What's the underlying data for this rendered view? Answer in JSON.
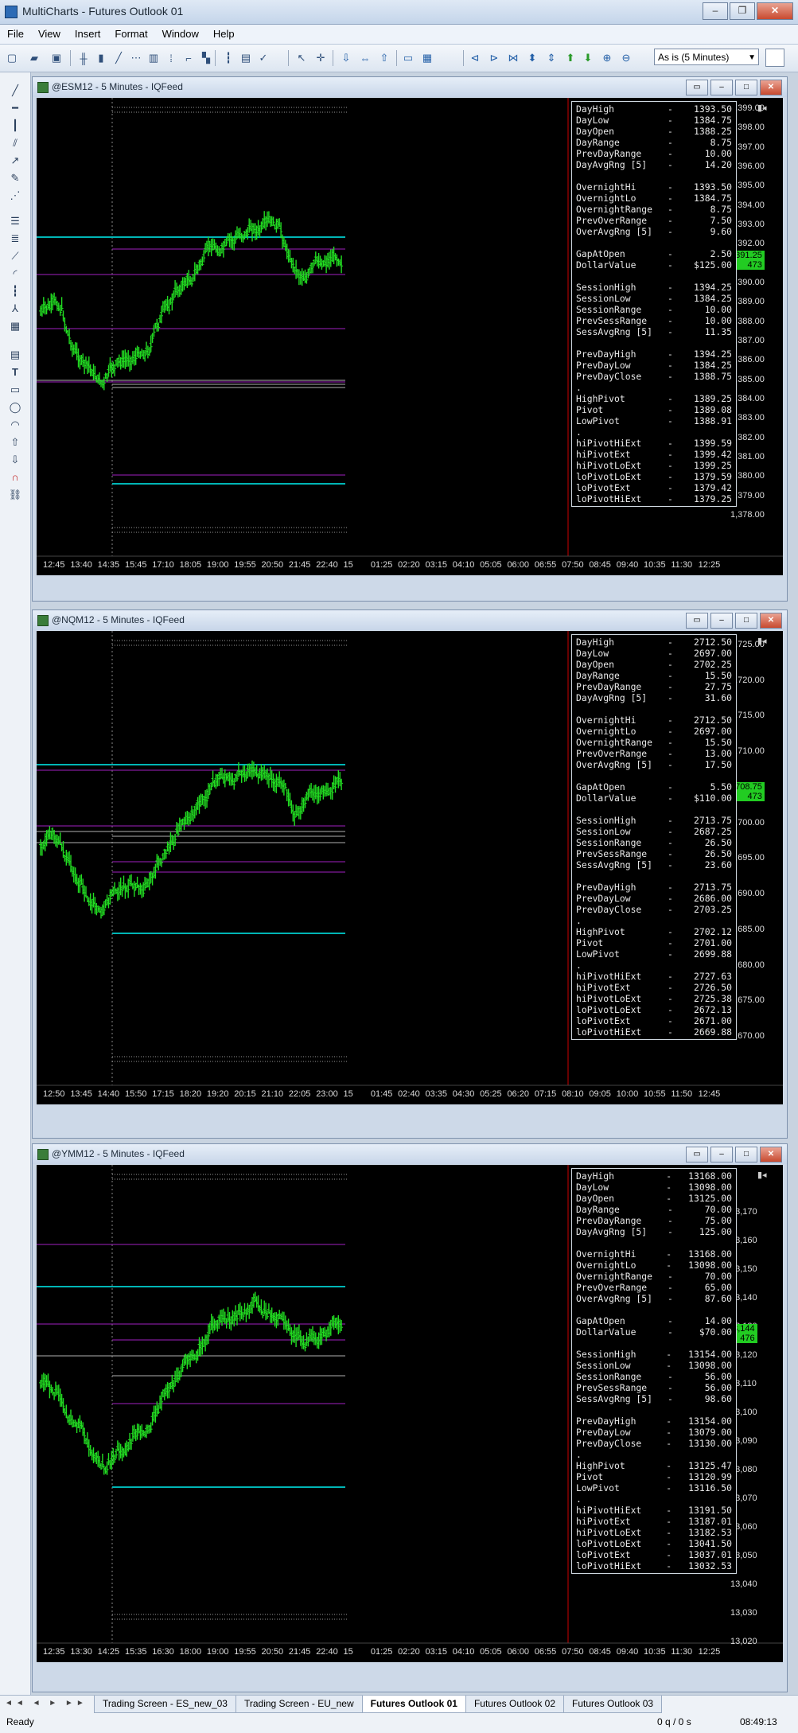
{
  "app": {
    "title": "MultiCharts - Futures Outlook 01"
  },
  "menu": [
    "File",
    "View",
    "Insert",
    "Format",
    "Window",
    "Help"
  ],
  "toolbar": {
    "resolution": "As is (5 Minutes)"
  },
  "charts": [
    {
      "title": "@ESM12 - 5 Minutes - IQFeed",
      "price": "1,391.25",
      "price_sub": "473",
      "yaxis": [
        "1,399.00",
        "1,398.00",
        "1,397.00",
        "1,396.00",
        "1,395.00",
        "1,394.00",
        "1,393.00",
        "1,392.00",
        "1,391.00",
        "1,390.00",
        "1,389.00",
        "1,388.00",
        "1,387.00",
        "1,386.00",
        "1,385.00",
        "1,384.00",
        "1,383.00",
        "1,382.00",
        "1,381.00",
        "1,380.00",
        "1,379.00",
        "1,378.00"
      ],
      "xaxis": [
        "12:45",
        "13:40",
        "14:35",
        "15:45",
        "17:10",
        "18:05",
        "19:00",
        "19:55",
        "20:50",
        "21:45",
        "22:40",
        "15",
        "01:25",
        "02:20",
        "03:15",
        "04:10",
        "05:05",
        "06:00",
        "06:55",
        "07:50",
        "08:45",
        "09:40",
        "10:35",
        "11:30",
        "12:25"
      ],
      "stats": [
        [
          "DayHigh",
          "1393.50"
        ],
        [
          "DayLow",
          "1384.75"
        ],
        [
          "DayOpen",
          "1388.25"
        ],
        [
          "DayRange",
          "8.75"
        ],
        [
          "PrevDayRange",
          "10.00"
        ],
        [
          "DayAvgRng [5]",
          "14.20"
        ],
        [
          "",
          ""
        ],
        [
          "OvernightHi",
          "1393.50"
        ],
        [
          "OvernightLo",
          "1384.75"
        ],
        [
          "OvernightRange",
          "8.75"
        ],
        [
          "PrevOverRange",
          "7.50"
        ],
        [
          "OverAvgRng [5]",
          "9.60"
        ],
        [
          "",
          ""
        ],
        [
          "GapAtOpen",
          "2.50"
        ],
        [
          "DollarValue",
          "$125.00"
        ],
        [
          "",
          ""
        ],
        [
          "SessionHigh",
          "1394.25"
        ],
        [
          "SessionLow",
          "1384.25"
        ],
        [
          "SessionRange",
          "10.00"
        ],
        [
          "PrevSessRange",
          "10.00"
        ],
        [
          "SessAvgRng [5]",
          "11.35"
        ],
        [
          "",
          ""
        ],
        [
          "PrevDayHigh",
          "1394.25"
        ],
        [
          "PrevDayLow",
          "1384.25"
        ],
        [
          "PrevDayClose",
          "1388.75"
        ],
        [
          ".",
          ""
        ],
        [
          "HighPivot",
          "1389.25"
        ],
        [
          "Pivot",
          "1389.08"
        ],
        [
          "LowPivot",
          "1388.91"
        ],
        [
          ".",
          ""
        ],
        [
          "hiPivotHiExt",
          "1399.59"
        ],
        [
          "hiPivotExt",
          "1399.42"
        ],
        [
          "hiPivotLoExt",
          "1399.25"
        ],
        [
          "loPivotLoExt",
          "1379.59"
        ],
        [
          "loPivotExt",
          "1379.42"
        ],
        [
          "loPivotHiExt",
          "1379.25"
        ]
      ]
    },
    {
      "title": "@NQM12 - 5 Minutes - IQFeed",
      "price": "2,708.75",
      "price_sub": "473",
      "yaxis": [
        "2,725.00",
        "2,720.00",
        "2,715.00",
        "2,710.00",
        "2,705.00",
        "2,700.00",
        "2,695.00",
        "2,690.00",
        "2,685.00",
        "2,680.00",
        "2,675.00",
        "2,670.00"
      ],
      "xaxis": [
        "12:50",
        "13:45",
        "14:40",
        "15:50",
        "17:15",
        "18:20",
        "19:20",
        "20:15",
        "21:10",
        "22:05",
        "23:00",
        "15",
        "01:45",
        "02:40",
        "03:35",
        "04:30",
        "05:25",
        "06:20",
        "07:15",
        "08:10",
        "09:05",
        "10:00",
        "10:55",
        "11:50",
        "12:45"
      ],
      "stats": [
        [
          "DayHigh",
          "2712.50"
        ],
        [
          "DayLow",
          "2697.00"
        ],
        [
          "DayOpen",
          "2702.25"
        ],
        [
          "DayRange",
          "15.50"
        ],
        [
          "PrevDayRange",
          "27.75"
        ],
        [
          "DayAvgRng [5]",
          "31.60"
        ],
        [
          "",
          ""
        ],
        [
          "OvernightHi",
          "2712.50"
        ],
        [
          "OvernightLo",
          "2697.00"
        ],
        [
          "OvernightRange",
          "15.50"
        ],
        [
          "PrevOverRange",
          "13.00"
        ],
        [
          "OverAvgRng [5]",
          "17.50"
        ],
        [
          "",
          ""
        ],
        [
          "GapAtOpen",
          "5.50"
        ],
        [
          "DollarValue",
          "$110.00"
        ],
        [
          "",
          ""
        ],
        [
          "SessionHigh",
          "2713.75"
        ],
        [
          "SessionLow",
          "2687.25"
        ],
        [
          "SessionRange",
          "26.50"
        ],
        [
          "PrevSessRange",
          "26.50"
        ],
        [
          "SessAvgRng [5]",
          "23.60"
        ],
        [
          "",
          ""
        ],
        [
          "PrevDayHigh",
          "2713.75"
        ],
        [
          "PrevDayLow",
          "2686.00"
        ],
        [
          "PrevDayClose",
          "2703.25"
        ],
        [
          ".",
          ""
        ],
        [
          "HighPivot",
          "2702.12"
        ],
        [
          "Pivot",
          "2701.00"
        ],
        [
          "LowPivot",
          "2699.88"
        ],
        [
          ".",
          ""
        ],
        [
          "hiPivotHiExt",
          "2727.63"
        ],
        [
          "hiPivotExt",
          "2726.50"
        ],
        [
          "hiPivotLoExt",
          "2725.38"
        ],
        [
          "loPivotLoExt",
          "2672.13"
        ],
        [
          "loPivotExt",
          "2671.00"
        ],
        [
          "loPivotHiExt",
          "2669.88"
        ]
      ]
    },
    {
      "title": "@YMM12 - 5 Minutes - IQFeed",
      "price": "13,144",
      "price_sub": "476",
      "yaxis": [
        "13,170",
        "13,160",
        "13,150",
        "13,140",
        "13,130",
        "13,120",
        "13,110",
        "13,100",
        "13,090",
        "13,080",
        "13,070",
        "13,060",
        "13,050",
        "13,040",
        "13,030",
        "13,020"
      ],
      "xaxis": [
        "12:35",
        "13:30",
        "14:25",
        "15:35",
        "16:30",
        "18:00",
        "19:00",
        "19:55",
        "20:50",
        "21:45",
        "22:40",
        "15",
        "01:25",
        "02:20",
        "03:15",
        "04:10",
        "05:05",
        "06:00",
        "06:55",
        "07:50",
        "08:45",
        "09:40",
        "10:35",
        "11:30",
        "12:25"
      ],
      "stats": [
        [
          "DayHigh",
          "13168.00"
        ],
        [
          "DayLow",
          "13098.00"
        ],
        [
          "DayOpen",
          "13125.00"
        ],
        [
          "DayRange",
          "70.00"
        ],
        [
          "PrevDayRange",
          "75.00"
        ],
        [
          "DayAvgRng [5]",
          "125.00"
        ],
        [
          "",
          ""
        ],
        [
          "OvernightHi",
          "13168.00"
        ],
        [
          "OvernightLo",
          "13098.00"
        ],
        [
          "OvernightRange",
          "70.00"
        ],
        [
          "PrevOverRange",
          "65.00"
        ],
        [
          "OverAvgRng [5]",
          "87.60"
        ],
        [
          "",
          ""
        ],
        [
          "GapAtOpen",
          "14.00"
        ],
        [
          "DollarValue",
          "$70.00"
        ],
        [
          "",
          ""
        ],
        [
          "SessionHigh",
          "13154.00"
        ],
        [
          "SessionLow",
          "13098.00"
        ],
        [
          "SessionRange",
          "56.00"
        ],
        [
          "PrevSessRange",
          "56.00"
        ],
        [
          "SessAvgRng [5]",
          "98.60"
        ],
        [
          "",
          ""
        ],
        [
          "PrevDayHigh",
          "13154.00"
        ],
        [
          "PrevDayLow",
          "13079.00"
        ],
        [
          "PrevDayClose",
          "13130.00"
        ],
        [
          ".",
          ""
        ],
        [
          "HighPivot",
          "13125.47"
        ],
        [
          "Pivot",
          "13120.99"
        ],
        [
          "LowPivot",
          "13116.50"
        ],
        [
          ".",
          ""
        ],
        [
          "hiPivotHiExt",
          "13191.50"
        ],
        [
          "hiPivotExt",
          "13187.01"
        ],
        [
          "hiPivotLoExt",
          "13182.53"
        ],
        [
          "loPivotLoExt",
          "13041.50"
        ],
        [
          "loPivotExt",
          "13037.01"
        ],
        [
          "loPivotHiExt",
          "13032.53"
        ]
      ]
    }
  ],
  "tabs": [
    "Trading Screen - ES_new_03",
    "Trading Screen - EU_new",
    "Futures Outlook 01",
    "Futures Outlook 02",
    "Futures Outlook 03"
  ],
  "active_tab": "Futures Outlook 01",
  "status": {
    "ready": "Ready",
    "queue": "0 q / 0 s",
    "time": "08:49:13"
  },
  "colors": {
    "bars": "#22dd22",
    "cyan_line": "#00b5b5",
    "purple_line": "#a020c0",
    "grey_line": "#b0b0b0",
    "price_badge": "#22cc22",
    "session_marker": "#cc0000"
  }
}
